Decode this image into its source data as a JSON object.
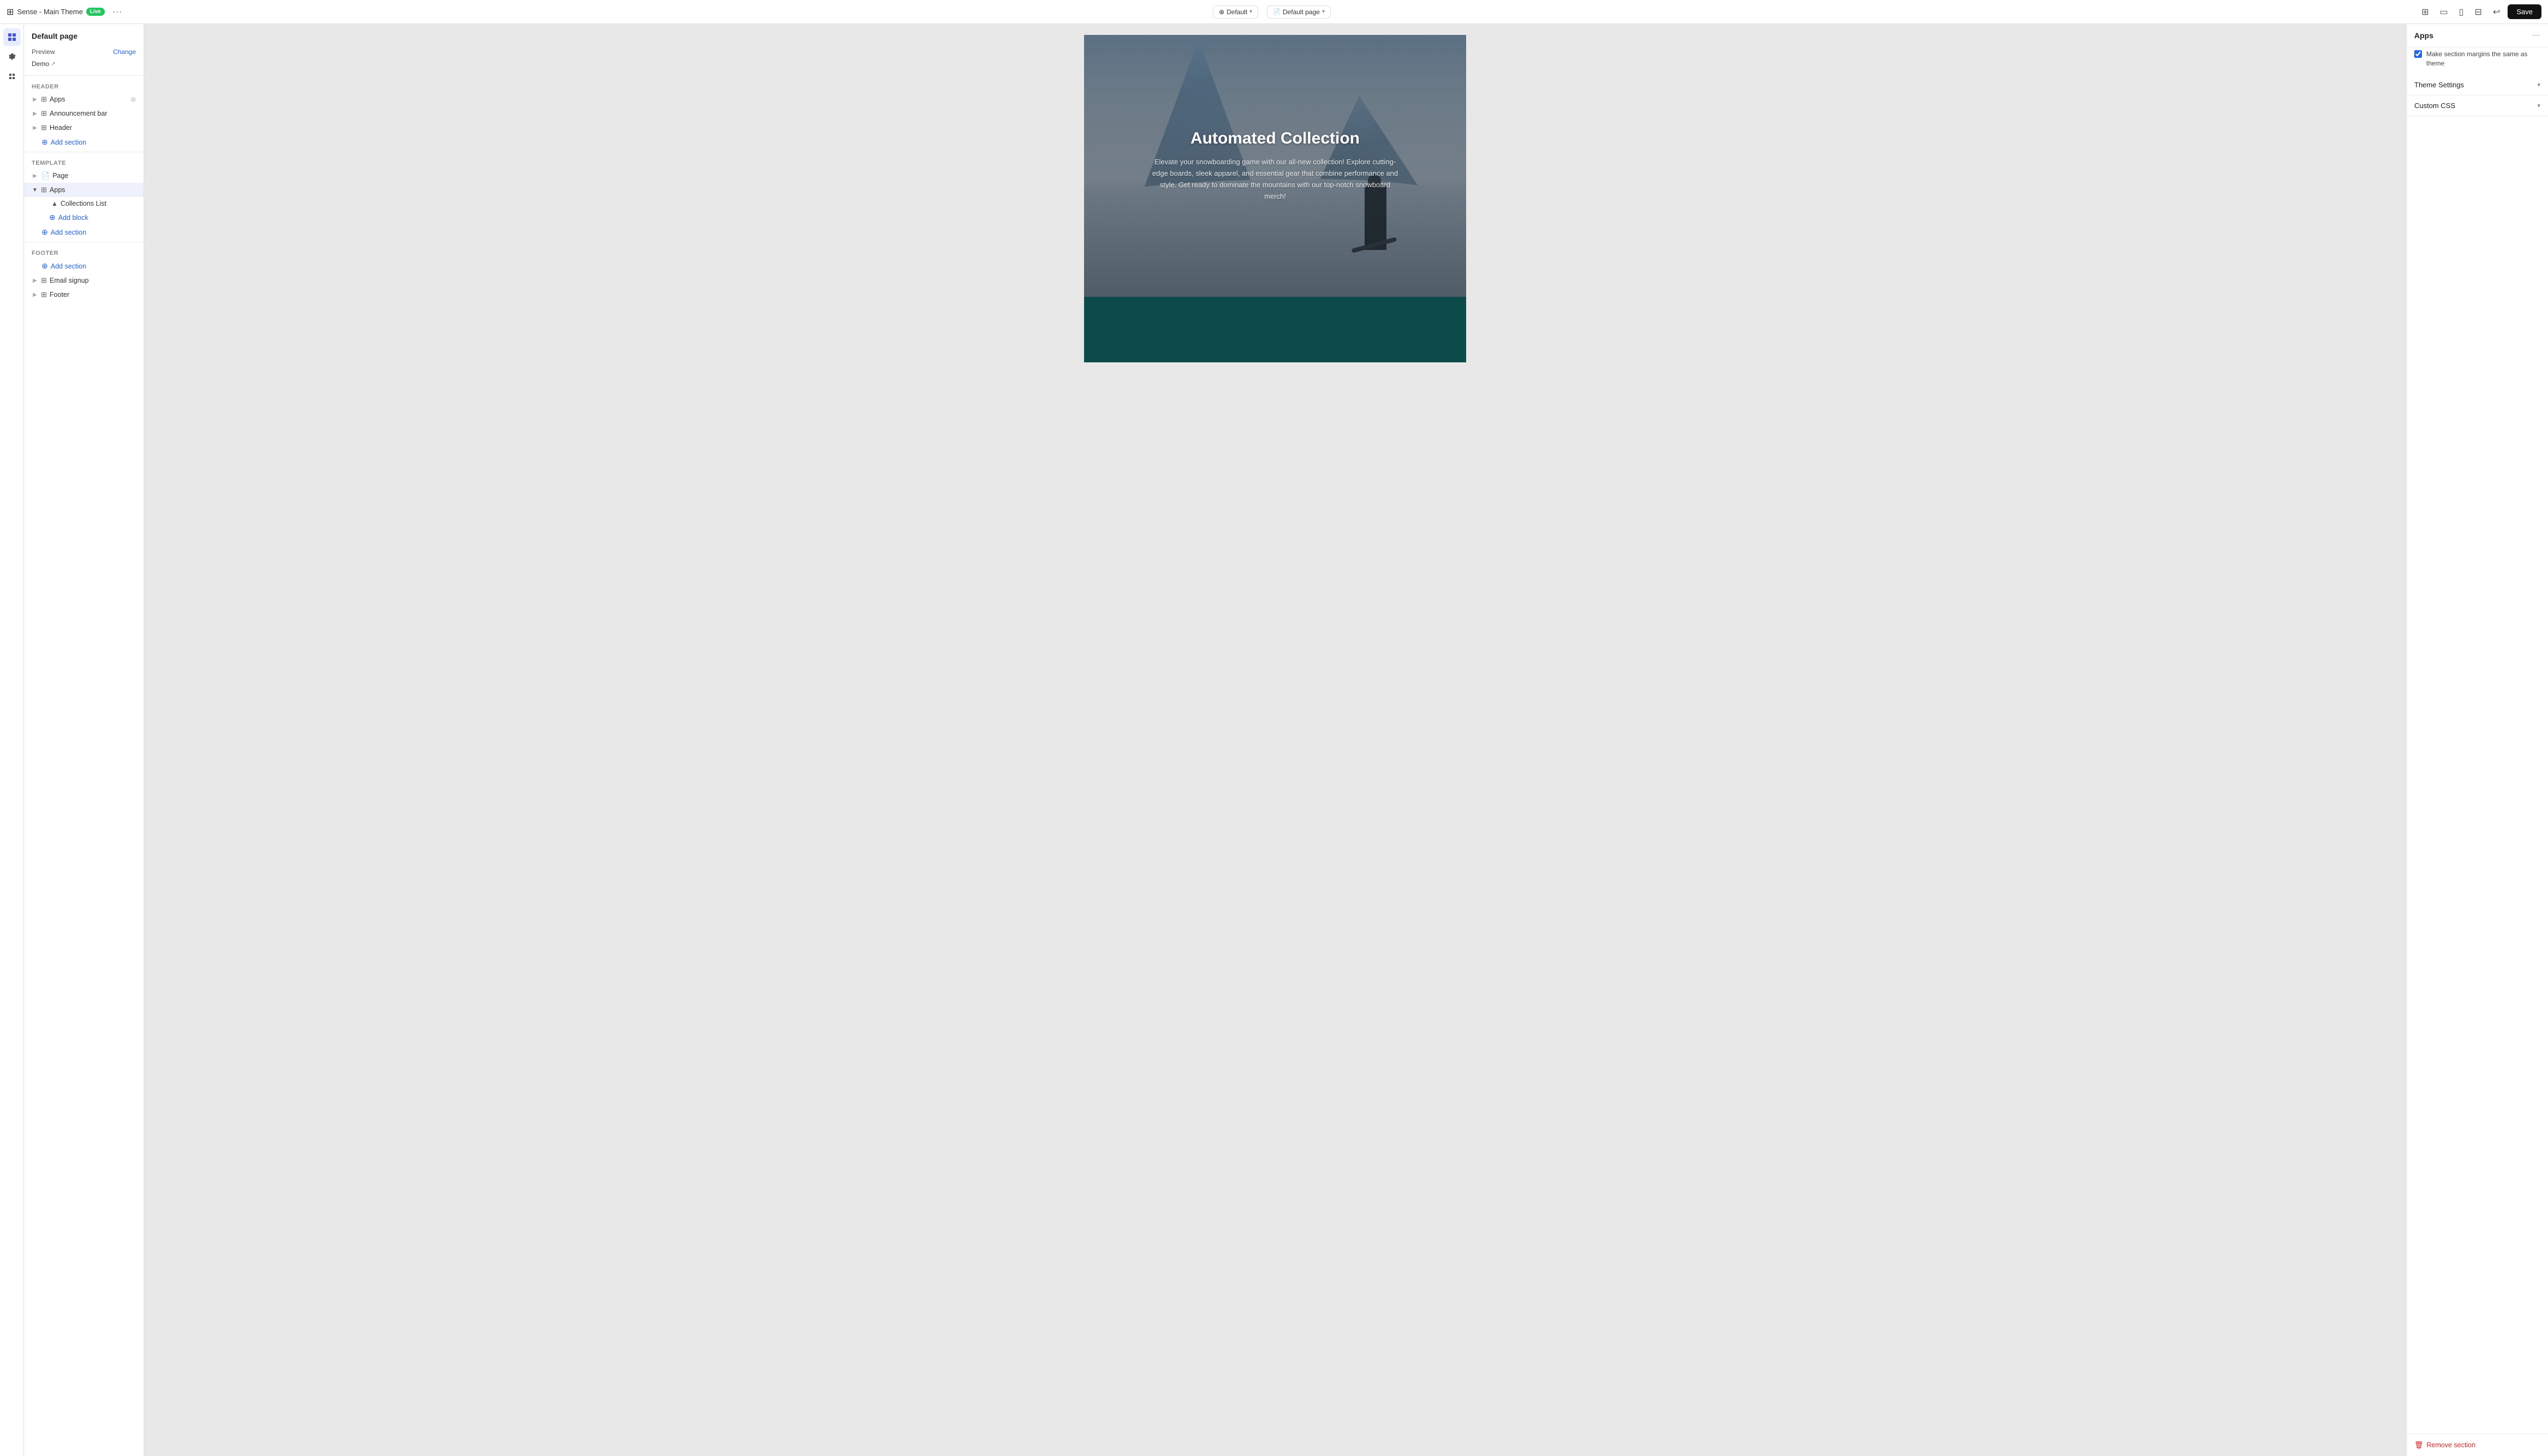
{
  "topbar": {
    "brand_name": "Sense - Main Theme",
    "live_label": "Live",
    "default_label": "Default",
    "default_page_label": "Default page",
    "save_label": "Save"
  },
  "left_panel": {
    "page_title": "Default page",
    "preview_label": "Preview",
    "preview_change": "Change",
    "preview_demo": "Demo",
    "header_label": "Header",
    "apps_label": "Apps",
    "announcement_bar_label": "Announcement bar",
    "header_item_label": "Header",
    "add_section_label": "Add section",
    "template_label": "Template",
    "page_item_label": "Page",
    "apps_template_label": "Apps",
    "collections_list_label": "Collections List",
    "add_block_label": "Add block",
    "footer_label": "Footer",
    "add_section_footer_label": "Add section",
    "email_signup_label": "Email signup",
    "footer_item_label": "Footer"
  },
  "canvas": {
    "hero_title": "Automated Collection",
    "hero_desc": "Elevate your snowboarding game with our all-new collection! Explore cutting-edge boards, sleek apparel, and essential gear that combine performance and style. Get ready to dominate the mountains with our top-notch snowboard merch!"
  },
  "right_panel": {
    "title": "Apps",
    "checkbox_label": "Make section margins the same as theme",
    "checkbox_checked": true,
    "theme_settings_label": "Theme Settings",
    "custom_css_label": "Custom CSS",
    "remove_section_label": "Remove section"
  }
}
